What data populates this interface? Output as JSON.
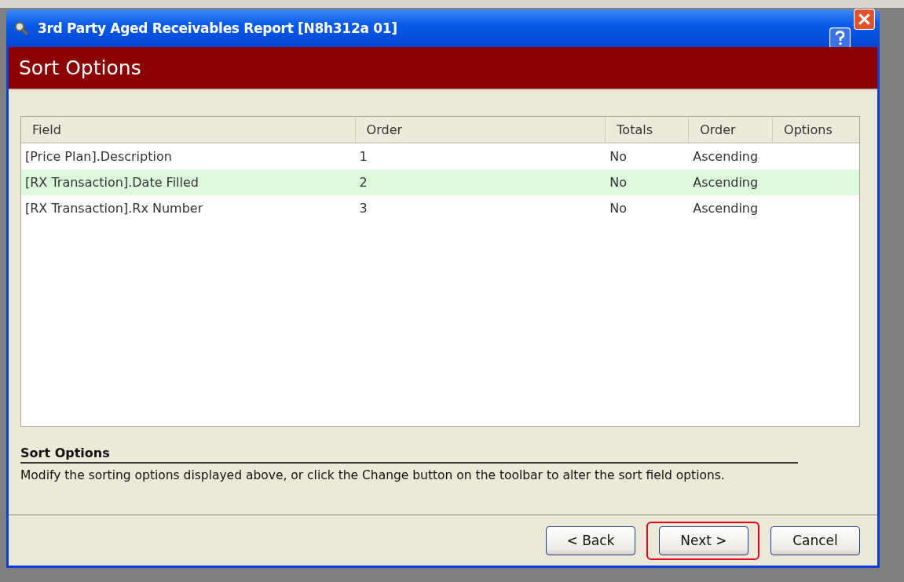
{
  "window": {
    "title": "3rd Party Aged Receivables Report [N8h312a 01]"
  },
  "header": {
    "title": "Sort Options"
  },
  "table": {
    "columns": [
      "Field",
      "Order",
      "Totals",
      "Order",
      "Options"
    ],
    "rows": [
      {
        "cells": [
          "[Price Plan].Description",
          "1",
          "No",
          "Ascending"
        ],
        "selected": false
      },
      {
        "cells": [
          "[RX Transaction].Date Filled",
          "2",
          "No",
          "Ascending"
        ],
        "selected": true
      },
      {
        "cells": [
          "[RX Transaction].Rx Number",
          "3",
          "No",
          "Ascending"
        ],
        "selected": false
      }
    ]
  },
  "help": {
    "title": "Sort Options",
    "text": "Modify the sorting options displayed above, or click the Change button on the toolbar to alter the sort field options."
  },
  "buttons": [
    {
      "label": "< Back",
      "highlighted": false
    },
    {
      "label": "Next >",
      "highlighted": true
    },
    {
      "label": "Cancel",
      "highlighted": false
    }
  ]
}
